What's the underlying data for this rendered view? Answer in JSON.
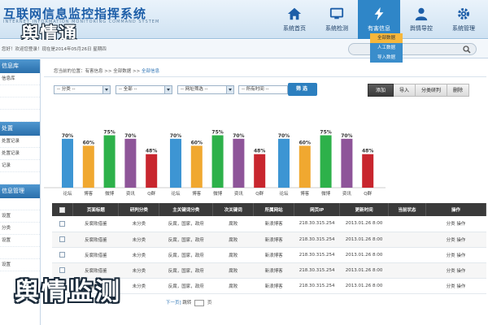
{
  "app": {
    "title": "互联网信息监控指挥系统",
    "subtitle": "INTERNET INFORMATION MONITORING COMMAND SYSTEM",
    "logo_text": "舆情通"
  },
  "nav": [
    {
      "label": "系统首页",
      "icon": "home-icon"
    },
    {
      "label": "系统检测",
      "icon": "monitor-icon"
    },
    {
      "label": "有害信息",
      "icon": "lightning-icon",
      "active": true
    },
    {
      "label": "舆情导控",
      "icon": "user-icon"
    },
    {
      "label": "系统管理",
      "icon": "gear-icon"
    }
  ],
  "dropdown": {
    "items": [
      "全部数据",
      "人工数据",
      "导入数据"
    ],
    "highlighted_index": 0
  },
  "welcome": {
    "text": "您好！欢迎您登录！现在是2014年05月26日 星期四"
  },
  "search": {
    "placeholder": ""
  },
  "sidebar": {
    "sections": [
      {
        "title": "信息库",
        "items": [
          "信息库",
          "",
          "",
          ""
        ]
      },
      {
        "title": "处置",
        "items": [
          "处置记录",
          "处置记录",
          "记录",
          ""
        ]
      },
      {
        "title": "信息管理",
        "items": [
          "",
          "设置",
          "分类",
          "设置",
          "",
          "设置"
        ]
      }
    ]
  },
  "breadcrumb": {
    "prefix": "您当前的位置：有害信息",
    "sep": ">>",
    "middle": "全部数据",
    "current": "全部信息"
  },
  "filters": {
    "selects": [
      "-- 分类 --",
      "-- 全部 --",
      "-- 网址筛选 --",
      "-- 所有时间 --"
    ],
    "filter_button": "筛选"
  },
  "actions": [
    "添加",
    "导入",
    "分类研判",
    "删除"
  ],
  "chart_data": {
    "type": "bar",
    "categories": [
      "论坛",
      "博客",
      "微博",
      "资讯",
      "Q群",
      "论坛",
      "博客",
      "微博",
      "资讯",
      "Q群",
      "论坛",
      "博客",
      "微博",
      "资讯",
      "Q群"
    ],
    "values": [
      70,
      60,
      75,
      70,
      48,
      70,
      60,
      75,
      70,
      48,
      70,
      60,
      75,
      70,
      48
    ],
    "labels": [
      "70%",
      "60%",
      "75%",
      "70%",
      "48%",
      "70%",
      "60%",
      "75%",
      "70%",
      "48%",
      "70%",
      "60%",
      "75%",
      "70%",
      "48%"
    ],
    "colors": [
      "#3d95d3",
      "#f0a830",
      "#2db14a",
      "#8e5599",
      "#c8262e"
    ],
    "ylim": [
      0,
      100
    ],
    "title": "",
    "xlabel": "",
    "ylabel": ""
  },
  "table": {
    "headers": [
      "",
      "页面标题",
      "研判分类",
      "主关键词分类",
      "次关键词",
      "所属网站",
      "网页IP",
      "更新时间",
      "当前状态",
      "操作"
    ],
    "rows": [
      [
        "",
        "反腐败借鉴",
        "未分类",
        "反腐，国家，政府",
        "腐败",
        "新浪博客",
        "218.30.315.254",
        "2013.01.26 8:00",
        "",
        "分类 操作"
      ],
      [
        "",
        "反腐败借鉴",
        "未分类",
        "反腐，国家，政府",
        "腐败",
        "新浪博客",
        "218.30.315.254",
        "2013.01.26 8:00",
        "",
        "分类 操作"
      ],
      [
        "",
        "反腐败借鉴",
        "未分类",
        "反腐，国家，政府",
        "腐败",
        "新浪博客",
        "218.30.315.254",
        "2013.01.26 8:00",
        "",
        "分类 操作"
      ],
      [
        "",
        "反腐败借鉴",
        "未分类",
        "反腐，国家，政府",
        "腐败",
        "新浪博客",
        "218.30.315.254",
        "2013.01.26 8:00",
        "",
        "分类 操作"
      ],
      [
        "",
        "反腐败借鉴",
        "未分类",
        "反腐，国家，政府",
        "腐败",
        "新浪博客",
        "218.30.315.254",
        "2013.01.26 8:00",
        "",
        "分类 操作"
      ]
    ]
  },
  "pager": {
    "prev_link": "下一页]",
    "jump_label": "跳转",
    "page_unit": "页"
  },
  "watermark": {
    "text": "舆情监测"
  }
}
